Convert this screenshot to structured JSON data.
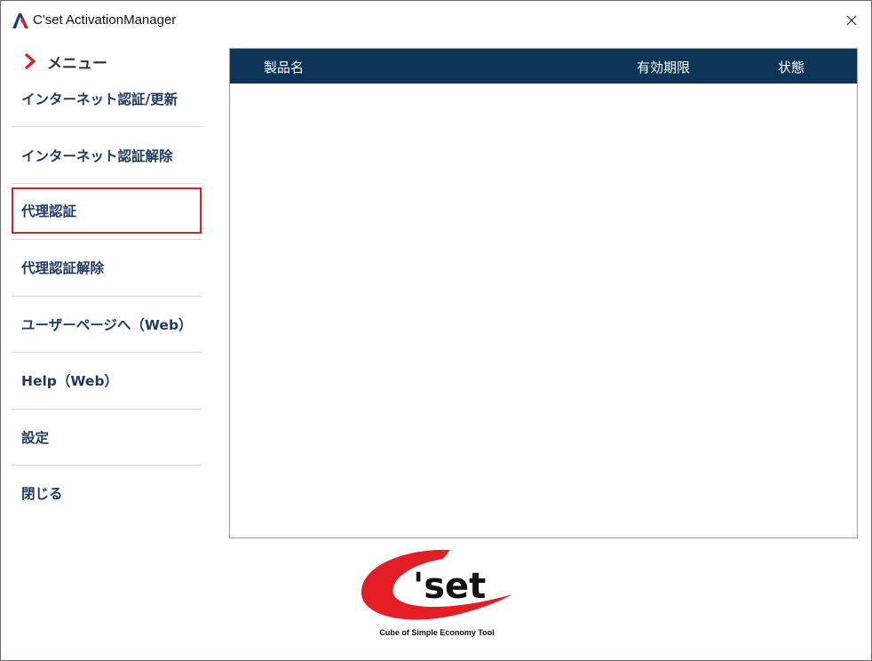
{
  "window": {
    "title": "C'set ActivationManager",
    "close_glyph": "×"
  },
  "sidebar": {
    "header": "メニュー",
    "selected_index": 2,
    "items": [
      {
        "label": "インターネット認証/更新"
      },
      {
        "label": "インターネット認証解除"
      },
      {
        "label": "代理認証"
      },
      {
        "label": "代理認証解除"
      },
      {
        "label": "ユーザーページへ（Web）"
      },
      {
        "label": "Help（Web）"
      },
      {
        "label": "設定"
      },
      {
        "label": "閉じる"
      }
    ]
  },
  "table": {
    "columns": [
      "製品名",
      "有効期限",
      "状態"
    ],
    "rows": []
  },
  "logo": {
    "wordmark": "'set",
    "tagline": "Cube of Simple Economy Tool"
  },
  "colors": {
    "accent_red": "#d0252e",
    "header_navy": "#0e3457",
    "menu_text": "#1e3a5f"
  }
}
